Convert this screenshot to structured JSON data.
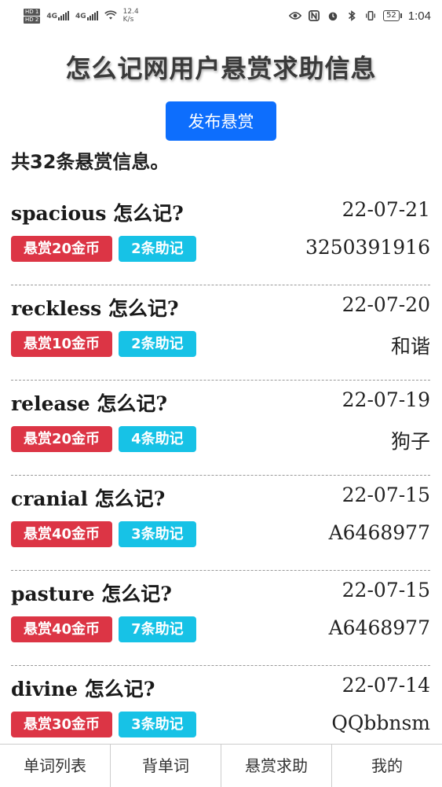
{
  "status_bar": {
    "sim1": "HD 1",
    "sim2": "HD 2",
    "net1": "4G",
    "net2": "4G",
    "speed_value": "12.4",
    "speed_unit": "K/s",
    "battery": "52",
    "time": "1:04"
  },
  "header": {
    "title": "怎么记网用户悬赏求助信息",
    "publish_button": "发布悬赏",
    "count_text": "共32条悬赏信息。"
  },
  "bounties": [
    {
      "word": "spacious 怎么记?",
      "date": "22-07-21",
      "reward": "悬赏20金币",
      "notes": "2条助记",
      "user": "3250391916"
    },
    {
      "word": "reckless 怎么记?",
      "date": "22-07-20",
      "reward": "悬赏10金币",
      "notes": "2条助记",
      "user": "和谐"
    },
    {
      "word": "release 怎么记?",
      "date": "22-07-19",
      "reward": "悬赏20金币",
      "notes": "4条助记",
      "user": "狗子"
    },
    {
      "word": "cranial 怎么记?",
      "date": "22-07-15",
      "reward": "悬赏40金币",
      "notes": "3条助记",
      "user": "A6468977"
    },
    {
      "word": "pasture 怎么记?",
      "date": "22-07-15",
      "reward": "悬赏40金币",
      "notes": "7条助记",
      "user": "A6468977"
    },
    {
      "word": "divine 怎么记?",
      "date": "22-07-14",
      "reward": "悬赏30金币",
      "notes": "3条助记",
      "user": "QQbbnsm"
    }
  ],
  "bottom_nav": [
    "单词列表",
    "背单词",
    "悬赏求助",
    "我的"
  ],
  "colors": {
    "primary": "#0d6efd",
    "reward_badge": "#dc3545",
    "notes_badge": "#17c2e6"
  }
}
